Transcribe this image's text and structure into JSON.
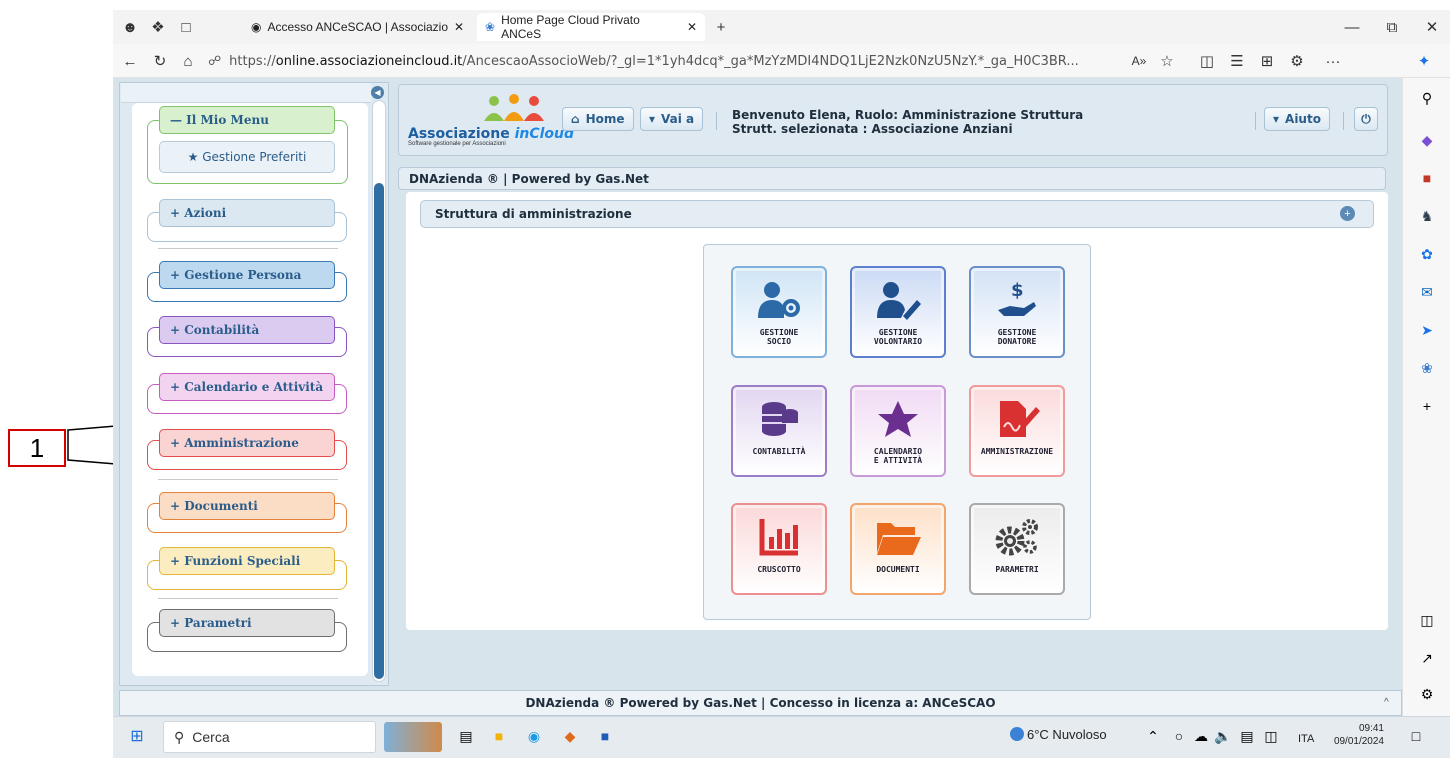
{
  "annotation": {
    "label": "1"
  },
  "browser": {
    "tabs": [
      {
        "title": "Accesso ANCeSCAO | Associazio"
      },
      {
        "title": "Home Page Cloud Privato ANCeS"
      }
    ],
    "url_prefix": "https://",
    "url_host": "online.associazioneincloud.it",
    "url_path": "/AncescaoAssocioWeb/?_gl=1*1yh4dcq*_ga*MzYzMDI4NDQ1LjE2Nzk0NzU5NzY.*_ga_H0C3BR...",
    "reader_label": "A»",
    "more_label": "···"
  },
  "left_menu": {
    "items": [
      {
        "label": "— Il Mio Menu",
        "border": "#7dc46a",
        "bg": "#d9f0cf"
      },
      {
        "label": "★ Gestione Preferiti",
        "border": "#b8cad8",
        "bg": "#eaf1f7"
      },
      {
        "label": "+ Azioni",
        "border": "#a9c2d6",
        "bg": "#dbe8f2"
      },
      {
        "label": "+ Gestione Persona",
        "border": "#3a78b5",
        "bg": "#bcd9f0"
      },
      {
        "label": "+ Contabilità",
        "border": "#8a55c2",
        "bg": "#dccbf0"
      },
      {
        "label": "+ Calendario e Attività",
        "border": "#c55cc0",
        "bg": "#f2d3f0"
      },
      {
        "label": "+ Amministrazione",
        "border": "#e34d4d",
        "bg": "#fad3d3"
      },
      {
        "label": "+ Documenti",
        "border": "#e5813a",
        "bg": "#fbdcc4"
      },
      {
        "label": "+ Funzioni Speciali",
        "border": "#e2b637",
        "bg": "#fbedc0"
      },
      {
        "label": "+ Parametri",
        "border": "#6e6e6e",
        "bg": "#e2e2e2"
      }
    ]
  },
  "header": {
    "logo_text": "Associazione",
    "logo_text_accent": "inCloud",
    "logo_sub": "Software gestionale per Associazioni",
    "home_label": "Home",
    "vai_label": "Vai a",
    "welcome_line1": "Benvenuto Elena, Ruolo: Amministrazione Struttura",
    "welcome_line2": "Strutt. selezionata : Associazione Anziani",
    "help_label": "Aiuto"
  },
  "dna_bar": "DNAzienda ® | Powered by Gas.Net",
  "struct_title": "Struttura di amministrazione",
  "tiles": [
    {
      "label": "GESTIONE\nSOCIO",
      "icon": "user-gear-icon",
      "color": "#2b6aa6",
      "border": "#7fb1dd",
      "bg": "#cfe4f5"
    },
    {
      "label": "GESTIONE\nVOLONTARIO",
      "icon": "user-pen-icon",
      "color": "#1f4f8d",
      "border": "#5d7fd0",
      "bg": "#cbdaf4"
    },
    {
      "label": "GESTIONE\nDONATORE",
      "icon": "hand-dollar-icon",
      "color": "#1f4f8d",
      "border": "#6b8fc8",
      "bg": "#d3e2f5"
    },
    {
      "label": "CONTABILITÀ",
      "icon": "coins-icon",
      "color": "#5a3a8a",
      "border": "#9c7ec8",
      "bg": "#e2d6f1"
    },
    {
      "label": "CALENDARIO\nE ATTIVITÀ",
      "icon": "star-icon",
      "color": "#6b2f8f",
      "border": "#c99ad8",
      "bg": "#f0daf4"
    },
    {
      "label": "AMMINISTRAZIONE",
      "icon": "document-pen-icon",
      "color": "#d93131",
      "border": "#f09a9a",
      "bg": "#fbdada"
    },
    {
      "label": "CRUSCOTTO",
      "icon": "bar-chart-icon",
      "color": "#d93131",
      "border": "#ef8e8e",
      "bg": "#fbd8d8"
    },
    {
      "label": "DOCUMENTI",
      "icon": "folder-icon",
      "color": "#ea6a1d",
      "border": "#f2a56c",
      "bg": "#fde0c8"
    },
    {
      "label": "PARAMETRI",
      "icon": "gears-icon",
      "color": "#444444",
      "border": "#aaaaaa",
      "bg": "#ececec"
    }
  ],
  "footer": "DNAzienda ® Powered by Gas.Net | Concesso in licenza a: ANCeSCAO",
  "taskbar": {
    "search_label": "Cerca",
    "weather": "6°C  Nuvoloso",
    "language": "ITA",
    "time": "09:41",
    "date": "09/01/2024"
  }
}
